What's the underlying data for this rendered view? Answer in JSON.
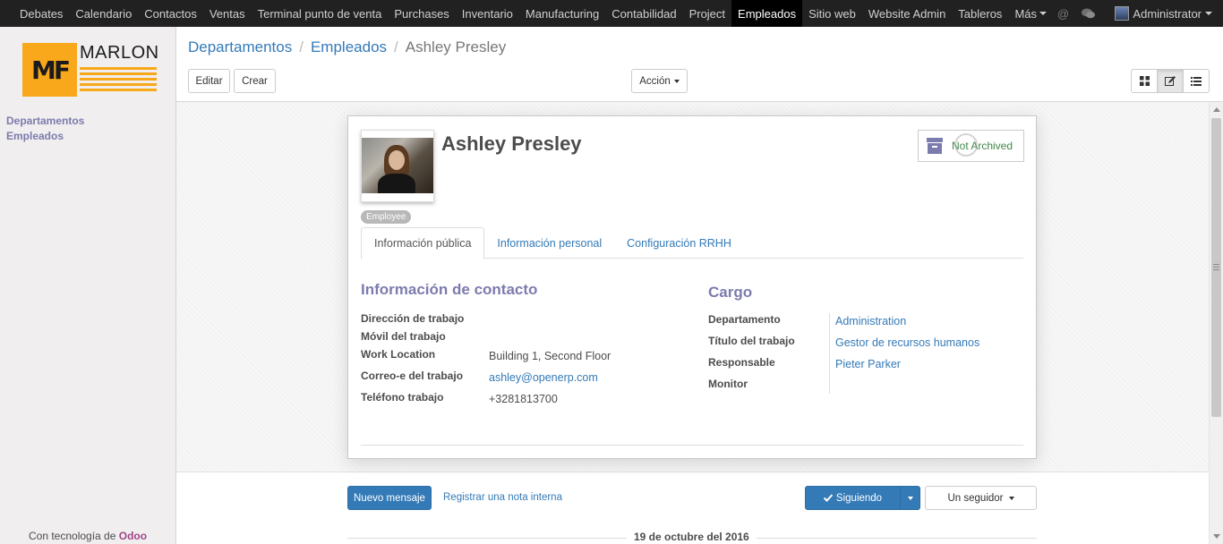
{
  "topbar": {
    "menu": [
      {
        "label": "Debates",
        "name": "debates"
      },
      {
        "label": "Calendario",
        "name": "calendario"
      },
      {
        "label": "Contactos",
        "name": "contactos"
      },
      {
        "label": "Ventas",
        "name": "ventas"
      },
      {
        "label": "Terminal punto de venta",
        "name": "terminal-punto-de-venta"
      },
      {
        "label": "Purchases",
        "name": "purchases"
      },
      {
        "label": "Inventario",
        "name": "inventario"
      },
      {
        "label": "Manufacturing",
        "name": "manufacturing"
      },
      {
        "label": "Contabilidad",
        "name": "contabilidad"
      },
      {
        "label": "Project",
        "name": "project"
      },
      {
        "label": "Empleados",
        "name": "empleados",
        "active": true
      },
      {
        "label": "Sitio web",
        "name": "sitio-web"
      },
      {
        "label": "Website Admin",
        "name": "website-admin"
      },
      {
        "label": "Tableros",
        "name": "tableros"
      },
      {
        "label": "Más",
        "name": "mas",
        "dropdown": true
      }
    ],
    "user": "Administrator",
    "icons": [
      "at-icon",
      "comments-icon"
    ]
  },
  "sidebar": {
    "logo_text": "MARLON",
    "logo_mark": "MF",
    "items": [
      "Departamentos",
      "Empleados"
    ],
    "powered_prefix": "Con tecnología de",
    "powered_brand": "Odoo"
  },
  "breadcrumb": {
    "items": [
      "Departamentos",
      "Empleados"
    ],
    "current": "Ashley Presley"
  },
  "buttons": {
    "edit": "Editar",
    "create": "Crear",
    "action": "Acción"
  },
  "employee": {
    "name": "Ashley Presley",
    "archive_status": "Not Archived",
    "tag": "Employee",
    "tabs": [
      "Información pública",
      "Información personal",
      "Configuración RRHH"
    ],
    "contact": {
      "title": "Información de contacto",
      "fields": [
        {
          "label": "Dirección de trabajo",
          "value": ""
        },
        {
          "label": "Móvil del trabajo",
          "value": ""
        },
        {
          "label": "Work Location",
          "value": "Building 1, Second Floor"
        },
        {
          "label": "Correo-e del trabajo",
          "value": "ashley@openerp.com"
        },
        {
          "label": "Teléfono trabajo",
          "value": "+3281813700"
        }
      ]
    },
    "position": {
      "title": "Cargo",
      "fields": [
        {
          "label": "Departamento",
          "value": "Administration"
        },
        {
          "label": "Título del trabajo",
          "value": "Gestor de recursos humanos"
        },
        {
          "label": "Responsable",
          "value": "Pieter Parker"
        },
        {
          "label": "Monitor",
          "value": ""
        }
      ]
    }
  },
  "chatter": {
    "new_message": "Nuevo mensaje",
    "log_note": "Registrar una nota interna",
    "following": "Siguiendo",
    "followers": "Un seguidor",
    "date": "19 de octubre del 2016"
  },
  "colors": {
    "accent": "#7c7bad",
    "link": "#337ab7",
    "topbar": "#212121",
    "brand": "#f8a81a"
  }
}
